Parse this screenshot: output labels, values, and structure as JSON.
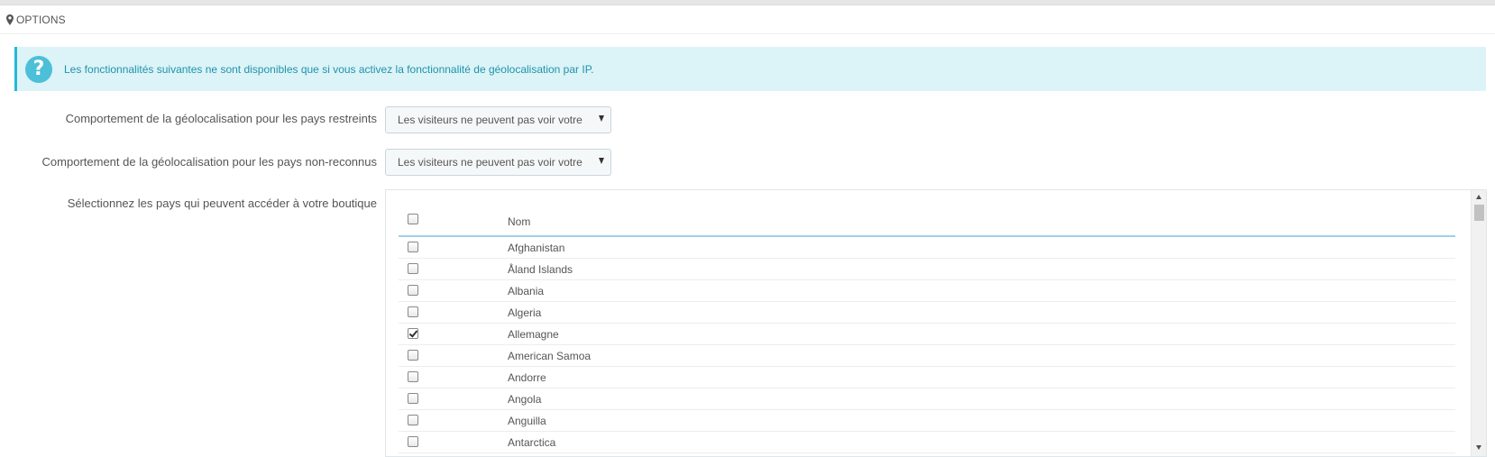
{
  "panel": {
    "title": "OPTIONS",
    "icon": "map-marker-icon"
  },
  "alert": {
    "icon": "question-circle-icon",
    "text": "Les fonctionnalités suivantes ne sont disponibles que si vous activez la fonctionnalité de géolocalisation par IP."
  },
  "fields": {
    "restricted": {
      "label": "Comportement de la géolocalisation pour les pays restreints",
      "value": "Les visiteurs ne peuvent pas voir votre"
    },
    "unrecognized": {
      "label": "Comportement de la géolocalisation pour les pays non-reconnus",
      "value": "Les visiteurs ne peuvent pas voir votre"
    },
    "countries": {
      "label": "Sélectionnez les pays qui peuvent accéder à votre boutique"
    }
  },
  "table": {
    "header": "Nom",
    "rows": [
      {
        "name": "Afghanistan",
        "checked": false
      },
      {
        "name": "Åland Islands",
        "checked": false
      },
      {
        "name": "Albania",
        "checked": false
      },
      {
        "name": "Algeria",
        "checked": false
      },
      {
        "name": "Allemagne",
        "checked": true
      },
      {
        "name": "American Samoa",
        "checked": false
      },
      {
        "name": "Andorre",
        "checked": false
      },
      {
        "name": "Angola",
        "checked": false
      },
      {
        "name": "Anguilla",
        "checked": false
      },
      {
        "name": "Antarctica",
        "checked": false
      }
    ]
  },
  "colors": {
    "alert_bg": "#dcf3f8",
    "alert_accent": "#25b9d7",
    "alert_text": "#1e94ab"
  }
}
